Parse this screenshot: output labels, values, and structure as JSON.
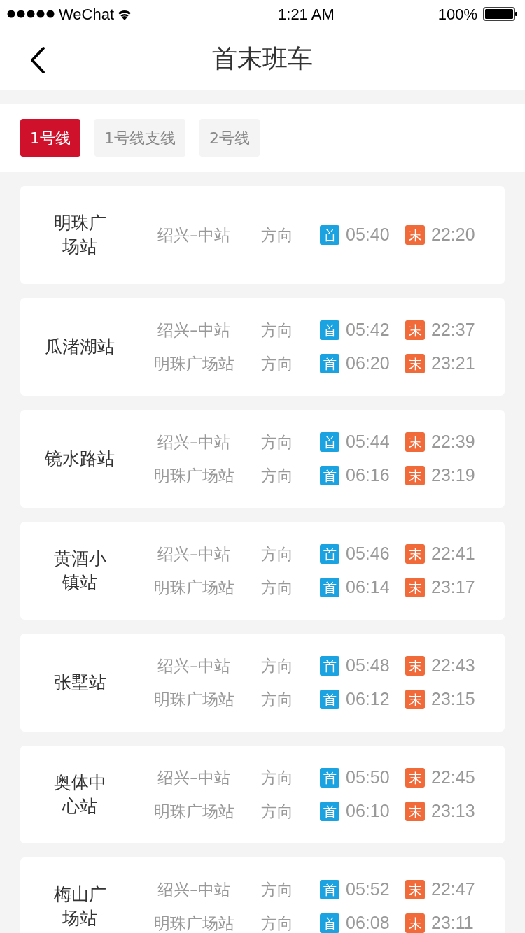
{
  "status_bar": {
    "carrier": "WeChat",
    "time": "1:21 AM",
    "battery": "100%"
  },
  "nav": {
    "title": "首末班车"
  },
  "tabs": [
    {
      "label": "1号线",
      "selected": true
    },
    {
      "label": "1号线支线",
      "selected": false
    },
    {
      "label": "2号线",
      "selected": false
    }
  ],
  "stations": [
    {
      "name": "明珠广场站",
      "rows": [
        {
          "direction": "绍兴–中站",
          "suffix": "方向",
          "first_badge": "首",
          "first": "05:40",
          "last_badge": "末",
          "last": "22:20"
        }
      ]
    },
    {
      "name": "瓜渚湖站",
      "rows": [
        {
          "direction": "绍兴–中站",
          "suffix": "方向",
          "first_badge": "首",
          "first": "05:42",
          "last_badge": "末",
          "last": "22:37"
        },
        {
          "direction": "明珠广场站",
          "suffix": "方向",
          "first_badge": "首",
          "first": "06:20",
          "last_badge": "末",
          "last": "23:21"
        }
      ]
    },
    {
      "name": "镜水路站",
      "rows": [
        {
          "direction": "绍兴–中站",
          "suffix": "方向",
          "first_badge": "首",
          "first": "05:44",
          "last_badge": "末",
          "last": "22:39"
        },
        {
          "direction": "明珠广场站",
          "suffix": "方向",
          "first_badge": "首",
          "first": "06:16",
          "last_badge": "末",
          "last": "23:19"
        }
      ]
    },
    {
      "name": "黄酒小镇站",
      "rows": [
        {
          "direction": "绍兴–中站",
          "suffix": "方向",
          "first_badge": "首",
          "first": "05:46",
          "last_badge": "末",
          "last": "22:41"
        },
        {
          "direction": "明珠广场站",
          "suffix": "方向",
          "first_badge": "首",
          "first": "06:14",
          "last_badge": "末",
          "last": "23:17"
        }
      ]
    },
    {
      "name": "张墅站",
      "rows": [
        {
          "direction": "绍兴–中站",
          "suffix": "方向",
          "first_badge": "首",
          "first": "05:48",
          "last_badge": "末",
          "last": "22:43"
        },
        {
          "direction": "明珠广场站",
          "suffix": "方向",
          "first_badge": "首",
          "first": "06:12",
          "last_badge": "末",
          "last": "23:15"
        }
      ]
    },
    {
      "name": "奥体中心站",
      "rows": [
        {
          "direction": "绍兴–中站",
          "suffix": "方向",
          "first_badge": "首",
          "first": "05:50",
          "last_badge": "末",
          "last": "22:45"
        },
        {
          "direction": "明珠广场站",
          "suffix": "方向",
          "first_badge": "首",
          "first": "06:10",
          "last_badge": "末",
          "last": "23:13"
        }
      ]
    },
    {
      "name": "梅山广场站",
      "rows": [
        {
          "direction": "绍兴–中站",
          "suffix": "方向",
          "first_badge": "首",
          "first": "05:52",
          "last_badge": "末",
          "last": "22:47"
        },
        {
          "direction": "明珠广场站",
          "suffix": "方向",
          "first_badge": "首",
          "first": "06:08",
          "last_badge": "末",
          "last": "23:11"
        }
      ]
    }
  ]
}
